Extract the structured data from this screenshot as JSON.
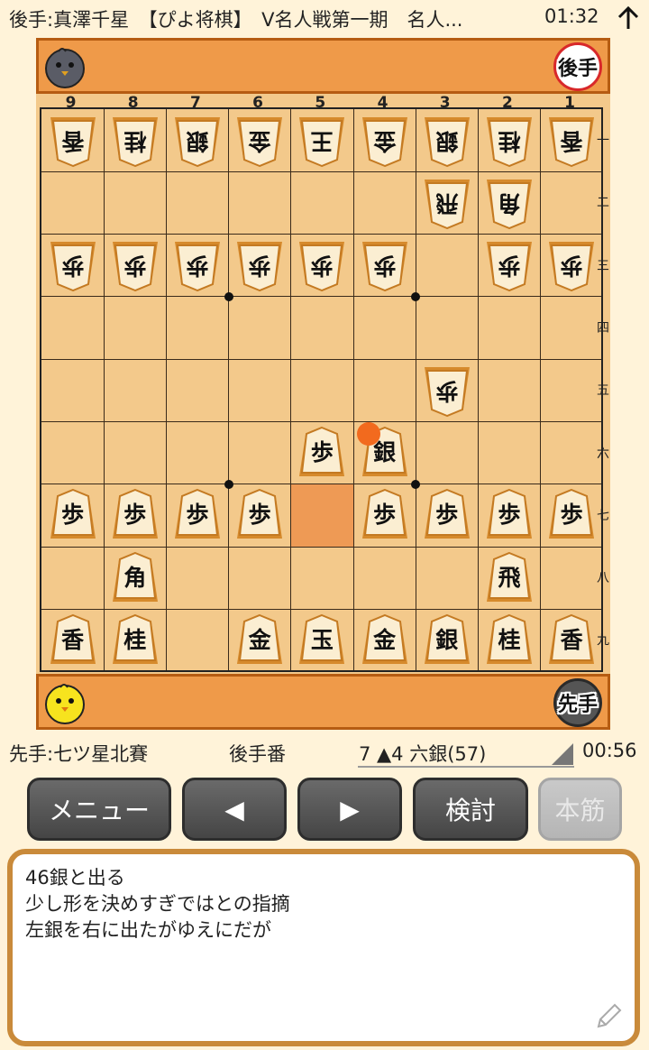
{
  "header": {
    "title": "後手:真澤千星　【ぴよ将棋】　V名人戦第一期　名人...",
    "gote_time": "01:32"
  },
  "stands": {
    "gote_label": "後手",
    "sente_label": "先手"
  },
  "board": {
    "col_labels": [
      "9",
      "8",
      "7",
      "6",
      "5",
      "4",
      "3",
      "2",
      "1"
    ],
    "row_labels": [
      "一",
      "二",
      "三",
      "四",
      "五",
      "六",
      "七",
      "八",
      "九"
    ],
    "pieces": [
      {
        "c": "香",
        "col": 9,
        "row": 1,
        "side": "gote"
      },
      {
        "c": "桂",
        "col": 8,
        "row": 1,
        "side": "gote"
      },
      {
        "c": "銀",
        "col": 7,
        "row": 1,
        "side": "gote"
      },
      {
        "c": "金",
        "col": 6,
        "row": 1,
        "side": "gote"
      },
      {
        "c": "王",
        "col": 5,
        "row": 1,
        "side": "gote"
      },
      {
        "c": "金",
        "col": 4,
        "row": 1,
        "side": "gote"
      },
      {
        "c": "銀",
        "col": 3,
        "row": 1,
        "side": "gote"
      },
      {
        "c": "桂",
        "col": 2,
        "row": 1,
        "side": "gote"
      },
      {
        "c": "香",
        "col": 1,
        "row": 1,
        "side": "gote"
      },
      {
        "c": "飛",
        "col": 3,
        "row": 2,
        "side": "gote"
      },
      {
        "c": "角",
        "col": 2,
        "row": 2,
        "side": "gote"
      },
      {
        "c": "歩",
        "col": 9,
        "row": 3,
        "side": "gote"
      },
      {
        "c": "歩",
        "col": 8,
        "row": 3,
        "side": "gote"
      },
      {
        "c": "歩",
        "col": 7,
        "row": 3,
        "side": "gote"
      },
      {
        "c": "歩",
        "col": 6,
        "row": 3,
        "side": "gote"
      },
      {
        "c": "歩",
        "col": 5,
        "row": 3,
        "side": "gote"
      },
      {
        "c": "歩",
        "col": 4,
        "row": 3,
        "side": "gote"
      },
      {
        "c": "歩",
        "col": 2,
        "row": 3,
        "side": "gote"
      },
      {
        "c": "歩",
        "col": 1,
        "row": 3,
        "side": "gote"
      },
      {
        "c": "歩",
        "col": 3,
        "row": 5,
        "side": "gote"
      },
      {
        "c": "歩",
        "col": 5,
        "row": 6,
        "side": "sente"
      },
      {
        "c": "銀",
        "col": 4,
        "row": 6,
        "side": "sente"
      },
      {
        "c": "歩",
        "col": 9,
        "row": 7,
        "side": "sente"
      },
      {
        "c": "歩",
        "col": 8,
        "row": 7,
        "side": "sente"
      },
      {
        "c": "歩",
        "col": 7,
        "row": 7,
        "side": "sente"
      },
      {
        "c": "歩",
        "col": 6,
        "row": 7,
        "side": "sente"
      },
      {
        "c": "歩",
        "col": 4,
        "row": 7,
        "side": "sente"
      },
      {
        "c": "歩",
        "col": 3,
        "row": 7,
        "side": "sente"
      },
      {
        "c": "歩",
        "col": 2,
        "row": 7,
        "side": "sente"
      },
      {
        "c": "歩",
        "col": 1,
        "row": 7,
        "side": "sente"
      },
      {
        "c": "角",
        "col": 8,
        "row": 8,
        "side": "sente"
      },
      {
        "c": "飛",
        "col": 2,
        "row": 8,
        "side": "sente"
      },
      {
        "c": "香",
        "col": 9,
        "row": 9,
        "side": "sente"
      },
      {
        "c": "桂",
        "col": 8,
        "row": 9,
        "side": "sente"
      },
      {
        "c": "金",
        "col": 6,
        "row": 9,
        "side": "sente"
      },
      {
        "c": "玉",
        "col": 5,
        "row": 9,
        "side": "sente"
      },
      {
        "c": "金",
        "col": 4,
        "row": 9,
        "side": "sente"
      },
      {
        "c": "銀",
        "col": 3,
        "row": 9,
        "side": "sente"
      },
      {
        "c": "桂",
        "col": 2,
        "row": 9,
        "side": "sente"
      },
      {
        "c": "香",
        "col": 1,
        "row": 9,
        "side": "sente"
      }
    ],
    "highlight": {
      "col": 5,
      "row": 7
    },
    "colors": {
      "board": "#f3c98b",
      "stand": "#ef9a49",
      "highlight": "#ee9a55",
      "last_move": "#f26a1e"
    }
  },
  "status": {
    "sente_name": "先手:七ツ星北賽",
    "turn": "後手番",
    "move": "7 ▲4 六銀(57)",
    "sente_time": "00:56"
  },
  "buttons": {
    "menu": "メニュー",
    "prev": "◀",
    "next": "▶",
    "kentou": "検討",
    "honsuji": "本筋"
  },
  "comment": {
    "lines": "46銀と出る\n少し形を決めすぎではとの指摘\n左銀を右に出たがゆえにだが"
  }
}
